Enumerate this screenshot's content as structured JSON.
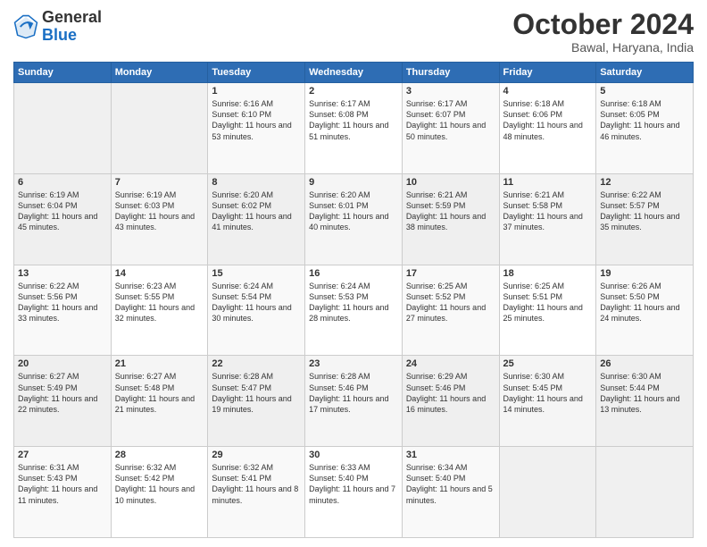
{
  "header": {
    "logo_general": "General",
    "logo_blue": "Blue",
    "title": "October 2024",
    "location": "Bawal, Haryana, India"
  },
  "calendar": {
    "days_of_week": [
      "Sunday",
      "Monday",
      "Tuesday",
      "Wednesday",
      "Thursday",
      "Friday",
      "Saturday"
    ],
    "weeks": [
      [
        {
          "day": "",
          "info": ""
        },
        {
          "day": "",
          "info": ""
        },
        {
          "day": "1",
          "info": "Sunrise: 6:16 AM\nSunset: 6:10 PM\nDaylight: 11 hours and 53 minutes."
        },
        {
          "day": "2",
          "info": "Sunrise: 6:17 AM\nSunset: 6:08 PM\nDaylight: 11 hours and 51 minutes."
        },
        {
          "day": "3",
          "info": "Sunrise: 6:17 AM\nSunset: 6:07 PM\nDaylight: 11 hours and 50 minutes."
        },
        {
          "day": "4",
          "info": "Sunrise: 6:18 AM\nSunset: 6:06 PM\nDaylight: 11 hours and 48 minutes."
        },
        {
          "day": "5",
          "info": "Sunrise: 6:18 AM\nSunset: 6:05 PM\nDaylight: 11 hours and 46 minutes."
        }
      ],
      [
        {
          "day": "6",
          "info": "Sunrise: 6:19 AM\nSunset: 6:04 PM\nDaylight: 11 hours and 45 minutes."
        },
        {
          "day": "7",
          "info": "Sunrise: 6:19 AM\nSunset: 6:03 PM\nDaylight: 11 hours and 43 minutes."
        },
        {
          "day": "8",
          "info": "Sunrise: 6:20 AM\nSunset: 6:02 PM\nDaylight: 11 hours and 41 minutes."
        },
        {
          "day": "9",
          "info": "Sunrise: 6:20 AM\nSunset: 6:01 PM\nDaylight: 11 hours and 40 minutes."
        },
        {
          "day": "10",
          "info": "Sunrise: 6:21 AM\nSunset: 5:59 PM\nDaylight: 11 hours and 38 minutes."
        },
        {
          "day": "11",
          "info": "Sunrise: 6:21 AM\nSunset: 5:58 PM\nDaylight: 11 hours and 37 minutes."
        },
        {
          "day": "12",
          "info": "Sunrise: 6:22 AM\nSunset: 5:57 PM\nDaylight: 11 hours and 35 minutes."
        }
      ],
      [
        {
          "day": "13",
          "info": "Sunrise: 6:22 AM\nSunset: 5:56 PM\nDaylight: 11 hours and 33 minutes."
        },
        {
          "day": "14",
          "info": "Sunrise: 6:23 AM\nSunset: 5:55 PM\nDaylight: 11 hours and 32 minutes."
        },
        {
          "day": "15",
          "info": "Sunrise: 6:24 AM\nSunset: 5:54 PM\nDaylight: 11 hours and 30 minutes."
        },
        {
          "day": "16",
          "info": "Sunrise: 6:24 AM\nSunset: 5:53 PM\nDaylight: 11 hours and 28 minutes."
        },
        {
          "day": "17",
          "info": "Sunrise: 6:25 AM\nSunset: 5:52 PM\nDaylight: 11 hours and 27 minutes."
        },
        {
          "day": "18",
          "info": "Sunrise: 6:25 AM\nSunset: 5:51 PM\nDaylight: 11 hours and 25 minutes."
        },
        {
          "day": "19",
          "info": "Sunrise: 6:26 AM\nSunset: 5:50 PM\nDaylight: 11 hours and 24 minutes."
        }
      ],
      [
        {
          "day": "20",
          "info": "Sunrise: 6:27 AM\nSunset: 5:49 PM\nDaylight: 11 hours and 22 minutes."
        },
        {
          "day": "21",
          "info": "Sunrise: 6:27 AM\nSunset: 5:48 PM\nDaylight: 11 hours and 21 minutes."
        },
        {
          "day": "22",
          "info": "Sunrise: 6:28 AM\nSunset: 5:47 PM\nDaylight: 11 hours and 19 minutes."
        },
        {
          "day": "23",
          "info": "Sunrise: 6:28 AM\nSunset: 5:46 PM\nDaylight: 11 hours and 17 minutes."
        },
        {
          "day": "24",
          "info": "Sunrise: 6:29 AM\nSunset: 5:46 PM\nDaylight: 11 hours and 16 minutes."
        },
        {
          "day": "25",
          "info": "Sunrise: 6:30 AM\nSunset: 5:45 PM\nDaylight: 11 hours and 14 minutes."
        },
        {
          "day": "26",
          "info": "Sunrise: 6:30 AM\nSunset: 5:44 PM\nDaylight: 11 hours and 13 minutes."
        }
      ],
      [
        {
          "day": "27",
          "info": "Sunrise: 6:31 AM\nSunset: 5:43 PM\nDaylight: 11 hours and 11 minutes."
        },
        {
          "day": "28",
          "info": "Sunrise: 6:32 AM\nSunset: 5:42 PM\nDaylight: 11 hours and 10 minutes."
        },
        {
          "day": "29",
          "info": "Sunrise: 6:32 AM\nSunset: 5:41 PM\nDaylight: 11 hours and 8 minutes."
        },
        {
          "day": "30",
          "info": "Sunrise: 6:33 AM\nSunset: 5:40 PM\nDaylight: 11 hours and 7 minutes."
        },
        {
          "day": "31",
          "info": "Sunrise: 6:34 AM\nSunset: 5:40 PM\nDaylight: 11 hours and 5 minutes."
        },
        {
          "day": "",
          "info": ""
        },
        {
          "day": "",
          "info": ""
        }
      ]
    ]
  }
}
